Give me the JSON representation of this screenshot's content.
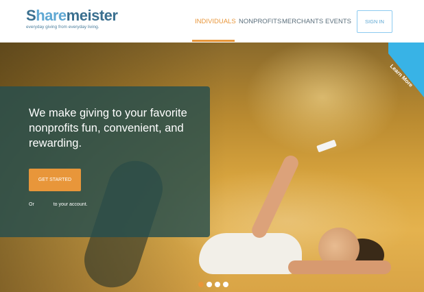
{
  "logo": {
    "name_part1": "S",
    "name_part2": "hare",
    "name_part3": "meister",
    "tagline": "everyday giving from everyday living."
  },
  "nav": {
    "items": [
      {
        "label": "INDIVIDUALS",
        "active": true
      },
      {
        "label": "NONPROFITS",
        "active": false
      },
      {
        "label": "MERCHANTS",
        "active": false
      },
      {
        "label": "EVENTS",
        "active": false
      }
    ],
    "sign_in": "SIGN IN"
  },
  "hero": {
    "headline": "We make giving to your favorite nonprofits fun, convenient, and rewarding.",
    "cta_label": "GET STARTED",
    "login_prefix": "Or",
    "login_link": "",
    "login_suffix": "to your account.",
    "ribbon_label": "Learn More",
    "carousel": {
      "count": 4,
      "active_index": 0
    }
  },
  "colors": {
    "accent": "#e8963a",
    "brand": "#3a6f8f",
    "ribbon": "#38b3e6",
    "overlay": "#264e4e"
  }
}
